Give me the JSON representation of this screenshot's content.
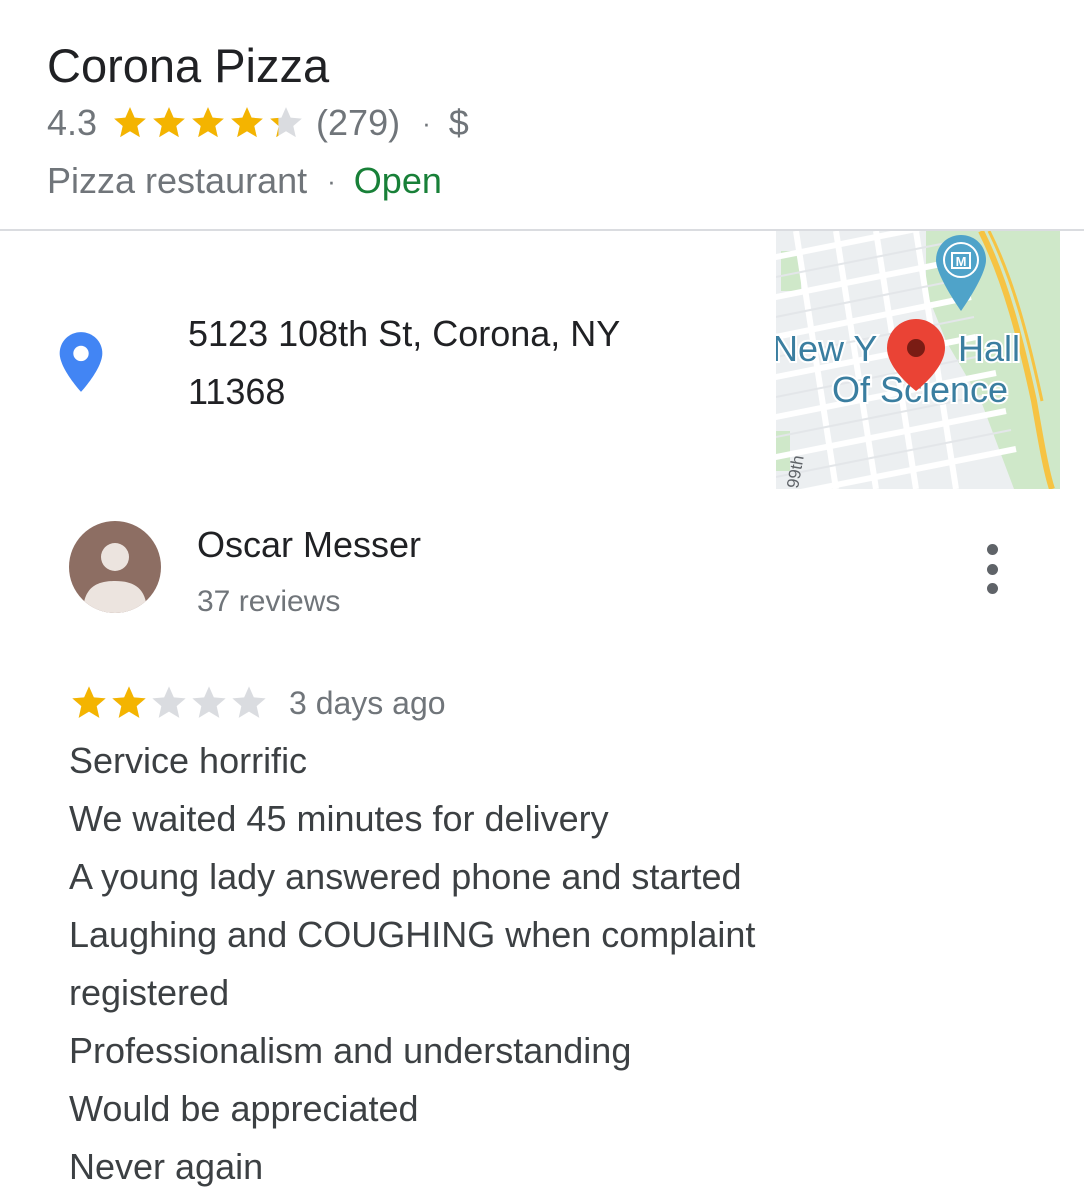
{
  "place": {
    "name": "Corona Pizza",
    "rating": "4.3",
    "rating_value": 4.3,
    "review_count": "(279)",
    "separator": "·",
    "price": "$",
    "category": "Pizza restaurant",
    "status": "Open"
  },
  "address": {
    "line1": "5123 108th St, Corona, NY",
    "line2": "11368",
    "icon": "location-pin-icon"
  },
  "map": {
    "label_line1": "New Y",
    "label_line1_end": "Hall",
    "label_line2": "Of Science",
    "street_label": "99th",
    "poi_icon": "museum-icon",
    "pin_icon": "red-map-pin-icon"
  },
  "review": {
    "reviewer_name": "Oscar Messer",
    "reviewer_reviews": "37 reviews",
    "stars": 2,
    "date": "3 days ago",
    "lines": [
      "Service horrific",
      "We waited 45 minutes for delivery",
      "A young lady answered phone and started",
      "Laughing and COUGHING when complaint",
      "registered",
      "Professionalism and understanding",
      "Would be appreciated",
      "Never again"
    ]
  },
  "colors": {
    "star_filled": "#f4b400",
    "star_empty": "#dadce0",
    "open_green": "#188038",
    "pin_blue": "#4285f4",
    "map_pin_red": "#ea4335"
  }
}
